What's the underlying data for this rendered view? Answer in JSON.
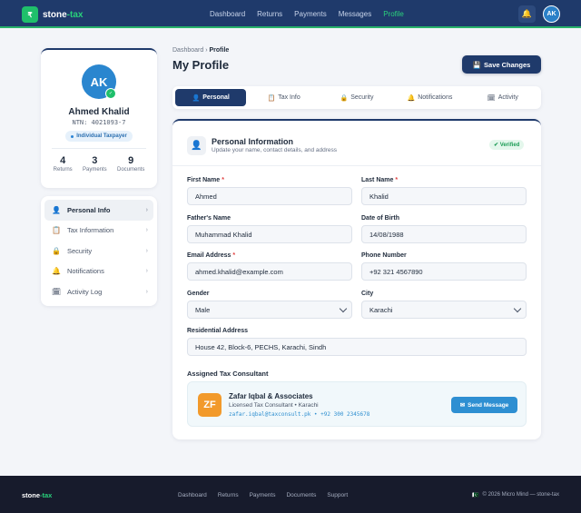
{
  "header": {
    "logo_glyph": "₹",
    "brand_part1": "stone",
    "brand_part2": "-tax",
    "nav": [
      "Dashboard",
      "Returns",
      "Payments",
      "Messages",
      "Profile"
    ],
    "active_nav": "Profile",
    "bell_icon": "🔔",
    "avatar_initials": "AK"
  },
  "profile": {
    "initials": "AK",
    "badge_icon": "✓",
    "name": "Ahmed Khalid",
    "ntn": "NTN: 4021093-7",
    "type": "Individual Taxpayer",
    "stats": [
      {
        "value": "4",
        "label": "Returns"
      },
      {
        "value": "3",
        "label": "Payments"
      },
      {
        "value": "9",
        "label": "Documents"
      }
    ]
  },
  "side_menu": [
    {
      "icon": "👤",
      "label": "Personal Info",
      "active": true
    },
    {
      "icon": "📋",
      "label": "Tax Information"
    },
    {
      "icon": "🔒",
      "label": "Security"
    },
    {
      "icon": "🔔",
      "label": "Notifications"
    },
    {
      "icon": "🗓",
      "label": "Activity Log"
    }
  ],
  "breadcrumb": {
    "parent": "Dashboard",
    "sep": "›",
    "current": "Profile"
  },
  "page_title": "My Profile",
  "save_button": {
    "icon": "💾",
    "label": "Save Changes"
  },
  "tabs": [
    {
      "icon": "👤",
      "label": "Personal",
      "active": true
    },
    {
      "icon": "📋",
      "label": "Tax Info"
    },
    {
      "icon": "🔒",
      "label": "Security"
    },
    {
      "icon": "🔔",
      "label": "Notifications"
    },
    {
      "icon": "🗓",
      "label": "Activity"
    }
  ],
  "section": {
    "icon": "👤",
    "title": "Personal Information",
    "subtitle": "Update your name, contact details, and address",
    "verified": "✔ Verified"
  },
  "form": {
    "first_name": {
      "label": "First Name",
      "value": "Ahmed"
    },
    "last_name": {
      "label": "Last Name",
      "value": "Khalid"
    },
    "father_name": {
      "label": "Father's Name",
      "value": "Muhammad Khalid"
    },
    "dob": {
      "label": "Date of Birth",
      "value": "14/08/1988"
    },
    "email": {
      "label": "Email Address",
      "value": "ahmed.khalid@example.com"
    },
    "phone": {
      "label": "Phone Number",
      "value": "+92 321 4567890"
    },
    "gender": {
      "label": "Gender",
      "value": "Male"
    },
    "city": {
      "label": "City",
      "value": "Karachi"
    },
    "address": {
      "label": "Residential Address",
      "value": "House 42, Block-6, PECHS, Karachi, Sindh"
    },
    "required_mark": "*"
  },
  "consultant": {
    "section_title": "Assigned Tax Consultant",
    "initials": "ZF",
    "name": "Zafar Iqbal & Associates",
    "role": "Licensed Tax Consultant • Karachi",
    "contact": "zafar.iqbal@taxconsult.pk • +92 300 2345678",
    "button_icon": "✉",
    "button_label": "Send Message"
  },
  "footer": {
    "brand_part1": "stone",
    "brand_part2": "-tax",
    "links": [
      "Dashboard",
      "Returns",
      "Payments",
      "Documents",
      "Support"
    ],
    "flag_icon": "🇵🇰",
    "copyright": "© 2026 Micro Mind — stone-tax"
  },
  "colors": {
    "header_bg": "#1f3a6b",
    "accent_green": "#29d27b",
    "primary_button": "#1f3a6b",
    "send_button": "#2e8fd2",
    "footer_bg": "#171b2c"
  }
}
